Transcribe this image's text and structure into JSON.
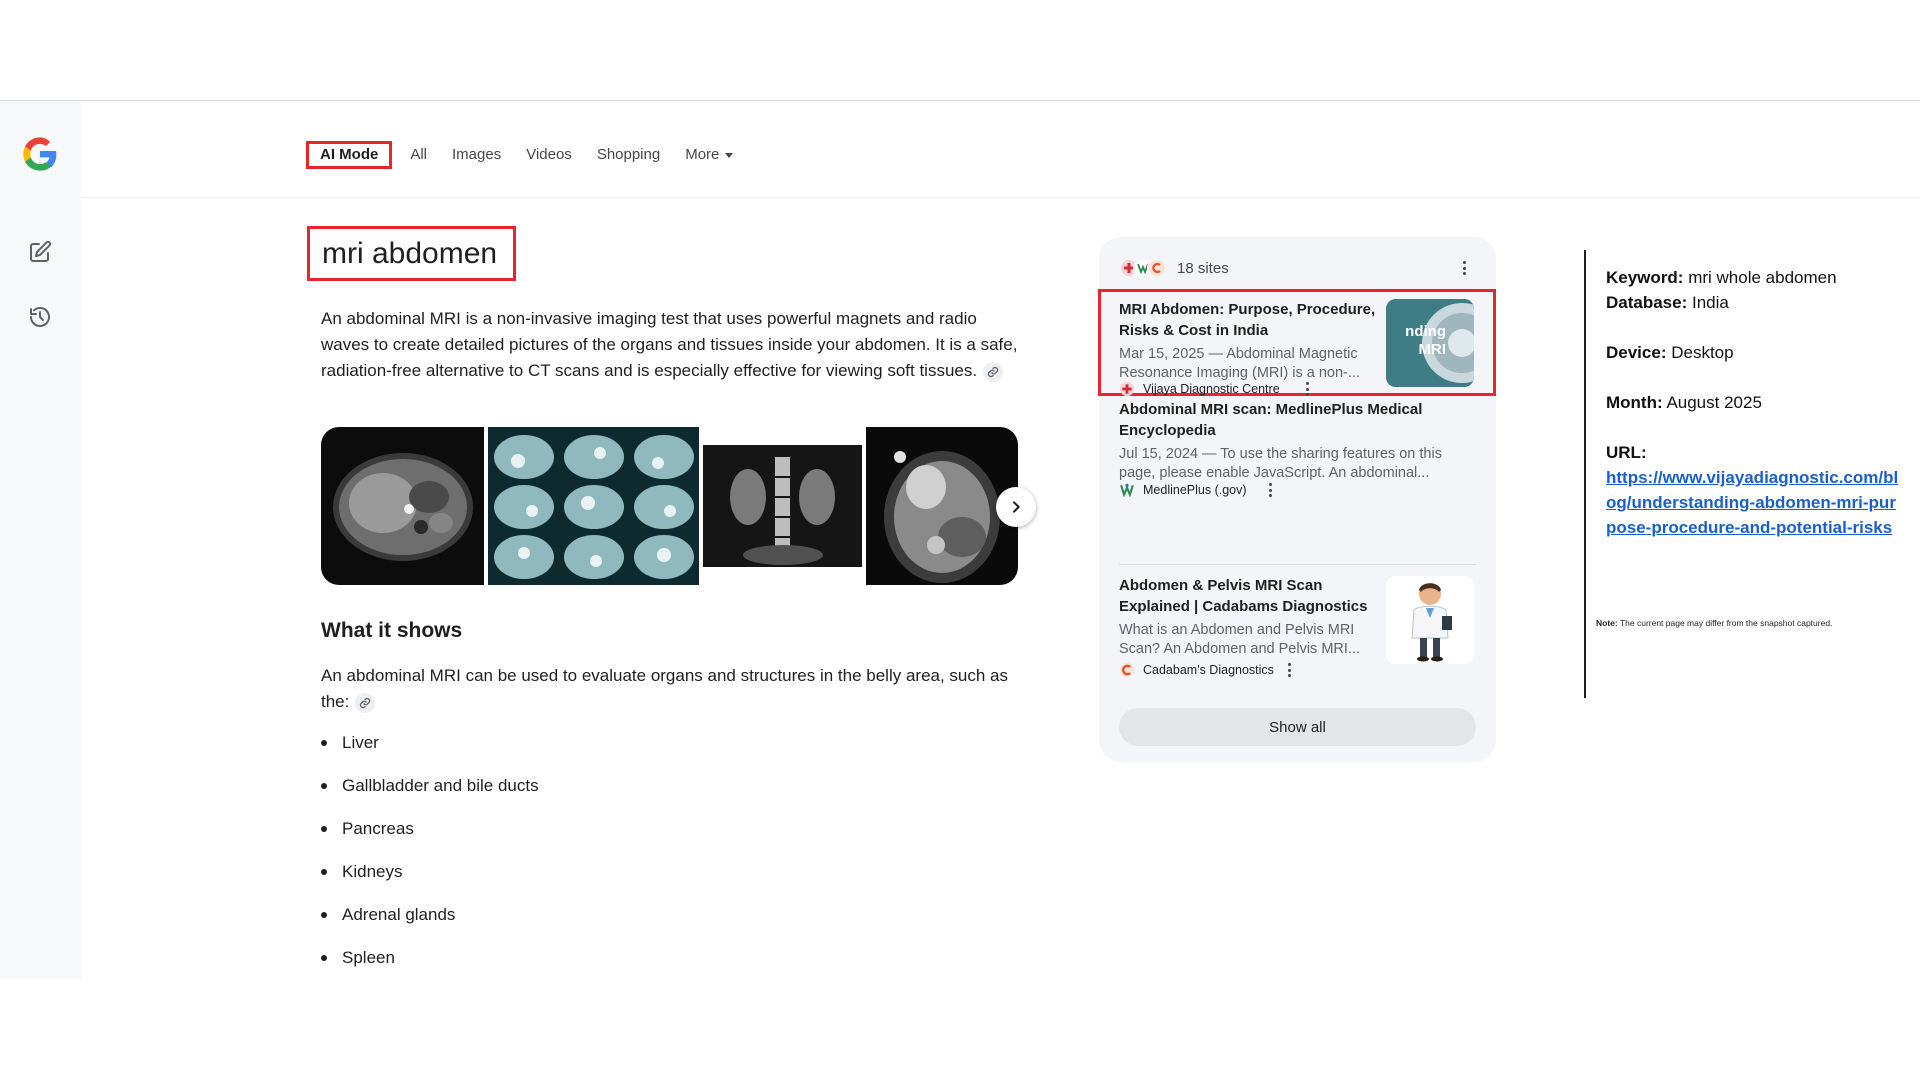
{
  "tabs": [
    {
      "label": "AI Mode",
      "active": true
    },
    {
      "label": "All"
    },
    {
      "label": "Images"
    },
    {
      "label": "Videos"
    },
    {
      "label": "Shopping"
    },
    {
      "label": "More"
    }
  ],
  "query": "mri abdomen",
  "intro_text": "An abdominal MRI is a non-invasive imaging test that uses powerful magnets and radio waves to create detailed pictures of the organs and tissues inside your abdomen. It is a safe, radiation-free alternative to CT scans and is especially effective for viewing soft tissues.",
  "section_heading": "What it shows",
  "section_text": "An abdominal MRI can be used to evaluate organs and structures in the belly area, such as the:",
  "organs": [
    "Liver",
    "Gallbladder and bile ducts",
    "Pancreas",
    "Kidneys",
    "Adrenal glands",
    "Spleen"
  ],
  "sources": {
    "count_label": "18 sites",
    "cards": [
      {
        "title": "MRI Abdomen: Purpose, Procedure, Risks & Cost in India",
        "snippet": "Mar 15, 2025 — Abdominal Magnetic Resonance Imaging (MRI) is a non-...",
        "source": "Vijaya Diagnostic Centre",
        "thumb_text": "nding MRI"
      },
      {
        "title": "Abdominal MRI scan: MedlinePlus Medical Encyclopedia",
        "snippet": "Jul 15, 2024 — To use the sharing features on this page, please enable JavaScript. An abdominal...",
        "source": "MedlinePlus (.gov)"
      },
      {
        "title": "Abdomen & Pelvis MRI Scan Explained | Cadabams Diagnostics",
        "snippet": "What is an Abdomen and Pelvis MRI Scan? An Abdomen and Pelvis MRI...",
        "source": "Cadabam's Diagnostics"
      }
    ],
    "show_all_label": "Show all"
  },
  "info": {
    "keyword_label": "Keyword:",
    "keyword": "mri whole abdomen",
    "database_label": "Database:",
    "database": "India",
    "device_label": "Device:",
    "device": "Desktop",
    "month_label": "Month:",
    "month": "August 2025",
    "url_label": "URL:",
    "url": "https://www.vijayadiagnostic.com/blog/understanding-abdomen-mri-purpose-procedure-and-potential-risks",
    "note_label": "Note:",
    "note": "The current page may differ from the snapshot captured."
  },
  "colors": {
    "highlight": "#e5262e",
    "link": "#1a5fcc",
    "panel_bg": "#f3f5f8"
  }
}
